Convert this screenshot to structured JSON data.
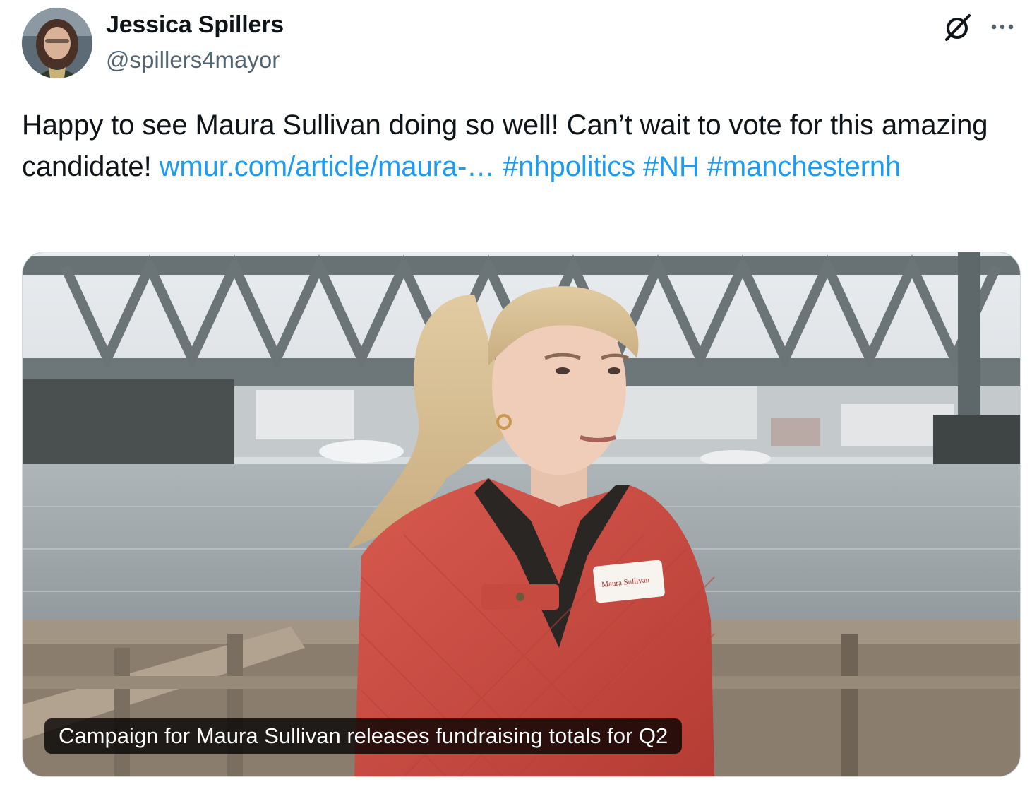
{
  "author": {
    "name": "Jessica Spillers",
    "handle": "@spillers4mayor"
  },
  "icons": {
    "grok": "grok-icon",
    "more": "more-options-icon"
  },
  "tweet": {
    "text_parts": [
      {
        "type": "text",
        "value": "Happy to see Maura Sullivan doing so well! Can’t wait to vote for this amazing candidate! "
      },
      {
        "type": "link",
        "value": "wmur.com/article/maura-…"
      },
      {
        "type": "text",
        "value": " "
      },
      {
        "type": "hashtag",
        "value": "#nhpolitics"
      },
      {
        "type": "text",
        "value": " "
      },
      {
        "type": "hashtag",
        "value": "#NH"
      },
      {
        "type": "text",
        "value": " "
      },
      {
        "type": "hashtag",
        "value": "#manchesternh"
      }
    ]
  },
  "media": {
    "caption": "Campaign for Maura Sullivan releases fundraising totals for Q2",
    "badge_text": "Maura Sullivan"
  },
  "colors": {
    "link": "#1d9bf0",
    "secondary_text": "#536471",
    "border": "#cfd9de"
  }
}
